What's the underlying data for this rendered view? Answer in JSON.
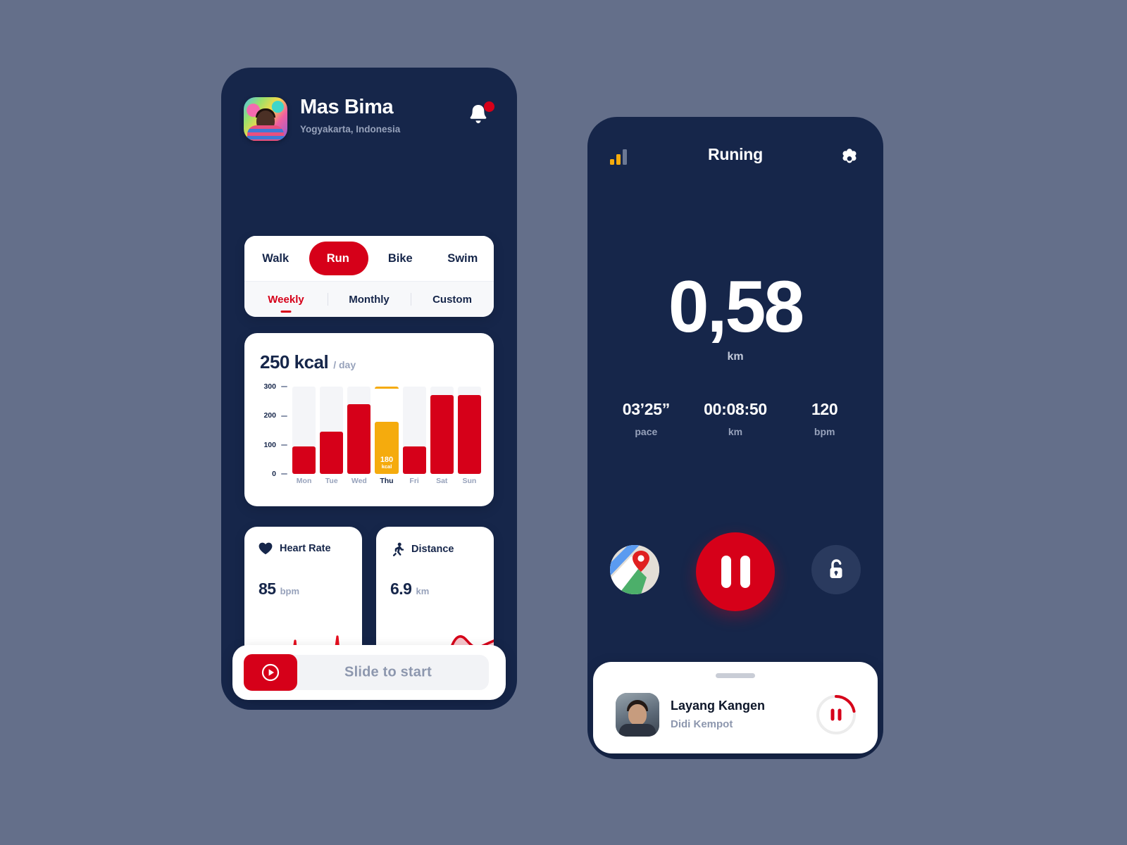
{
  "background_color": "#646f8a",
  "colors": {
    "navy": "#16264a",
    "red": "#d60019",
    "yellow": "#f5ab0d",
    "muted": "#97a2bb",
    "card": "#ffffff"
  },
  "left_phone": {
    "header": {
      "name": "Mas Bima",
      "location": "Yogyakarta, Indonesia",
      "avatar_icon": "user-avatar-photo",
      "bell_icon": "bell-icon",
      "bell_has_badge": true
    },
    "activity_tabs": {
      "items": [
        "Walk",
        "Run",
        "Bike",
        "Swim"
      ],
      "active": "Run"
    },
    "period_tabs": {
      "items": [
        "Weekly",
        "Monthly",
        "Custom"
      ],
      "active": "Weekly"
    },
    "calorie_card": {
      "value": "250 kcal",
      "per": "/ day"
    },
    "metrics": [
      {
        "title": "Heart Rate",
        "icon": "heart-icon",
        "value": "85",
        "unit": "bpm",
        "graph": "ecg-line"
      },
      {
        "title": "Distance",
        "icon": "running-person-icon",
        "value": "6.9",
        "unit": "km",
        "graph": "wave-area"
      }
    ],
    "slide_to_start": {
      "label": "Slide to start",
      "knob_icon": "play-icon"
    }
  },
  "chart_data": {
    "type": "bar",
    "title": "250 kcal / day",
    "xlabel": "",
    "ylabel": "",
    "ylim": [
      0,
      300
    ],
    "yticks": [
      0,
      100,
      200,
      300
    ],
    "grid": false,
    "categories": [
      "Mon",
      "Tue",
      "Wed",
      "Thu",
      "Fri",
      "Sat",
      "Sun"
    ],
    "values": [
      95,
      145,
      240,
      180,
      95,
      270,
      270
    ],
    "highlight_index": 3,
    "highlight_label": "180",
    "highlight_unit": "kcal",
    "bar_color": "#d60019",
    "highlight_color": "#f5ab0d",
    "track_color": "#f4f5f8"
  },
  "right_phone": {
    "header": {
      "title": "Runing",
      "signal_icon": "signal-bars-icon",
      "gear_icon": "gear-icon"
    },
    "distance": {
      "value": "0,58",
      "unit": "km"
    },
    "stats": [
      {
        "value": "03’25”",
        "label": "pace"
      },
      {
        "value": "00:08:50",
        "label": "km"
      },
      {
        "value": "120",
        "label": "bpm"
      }
    ],
    "controls": {
      "map_icon": "map-pin-icon",
      "pause_icon": "pause-icon",
      "lock_icon": "unlock-icon"
    },
    "music": {
      "title": "Layang Kangen",
      "artist": "Didi Kempot",
      "art_icon": "album-art-photo",
      "button_icon": "pause-icon",
      "progress_percent": 22
    }
  }
}
